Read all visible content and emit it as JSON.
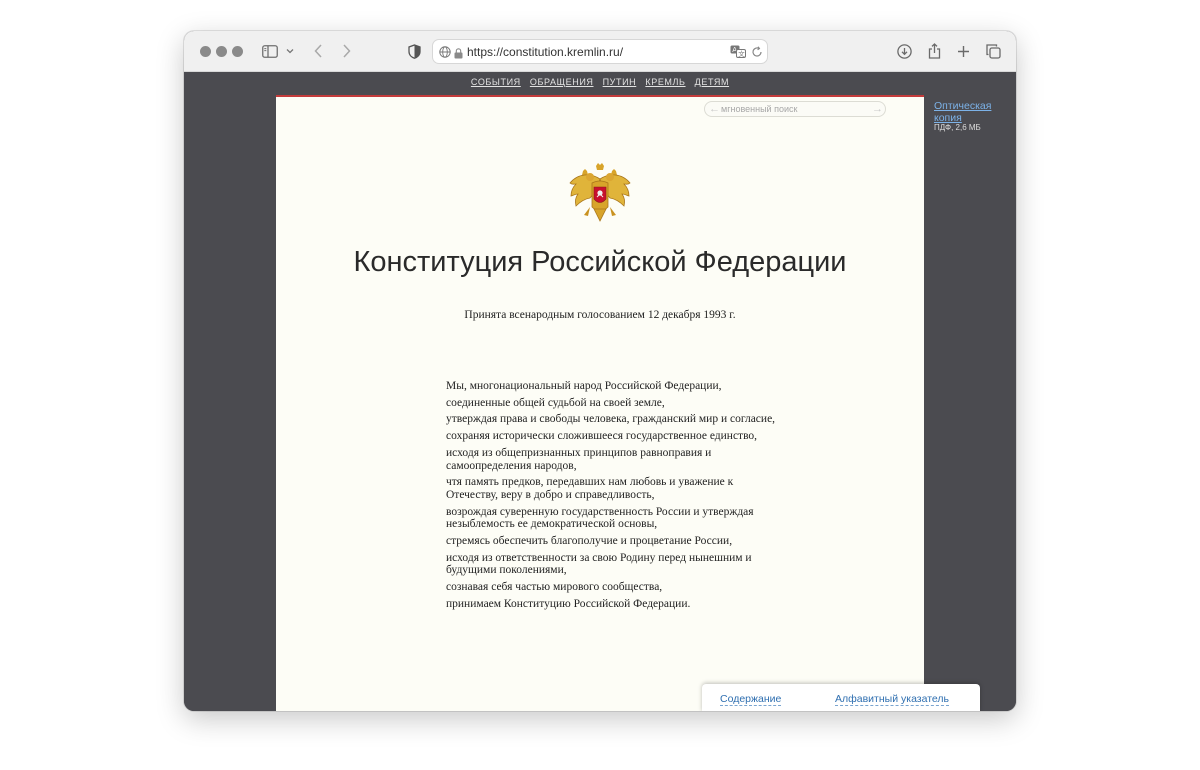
{
  "browser": {
    "url": "https://constitution.kremlin.ru/"
  },
  "site": {
    "nav": [
      "СОБЫТИЯ",
      "ОБРАЩЕНИЯ",
      "ПУТИН",
      "КРЕМЛЬ",
      "ДЕТЯМ"
    ],
    "search_placeholder": "мгновенный поиск",
    "side_link": "Оптическая копия",
    "side_meta": "ПДФ, 2,6 МБ"
  },
  "document": {
    "title": "Конституция Российской Федерации",
    "adopted": "Принята всенародным голосованием 12 декабря 1993 г.",
    "preamble": [
      "Мы, многонациональный народ Российской Федерации,",
      "соединенные общей судьбой на своей земле,",
      "утверждая права и свободы человека, гражданский мир и согласие,",
      "сохраняя исторически сложившееся государственное единство,",
      "исходя из общепризнанных принципов равноправия и самоопределения народов,",
      "чтя память предков, передавших нам любовь и уважение к Отечеству, веру в добро и справедливость,",
      "возрождая суверенную государственность России и утверждая незыблемость ее демократической основы,",
      "стремясь обеспечить благополучие и процветание России,",
      "исходя из ответственности за свою Родину перед нынешним и будущими поколениями,",
      "сознавая себя частью мирового сообщества,",
      "принимаем Конституцию Российской Федерации."
    ]
  },
  "bottom_bar": {
    "contents": "Содержание",
    "index": "Алфавитный указатель"
  }
}
